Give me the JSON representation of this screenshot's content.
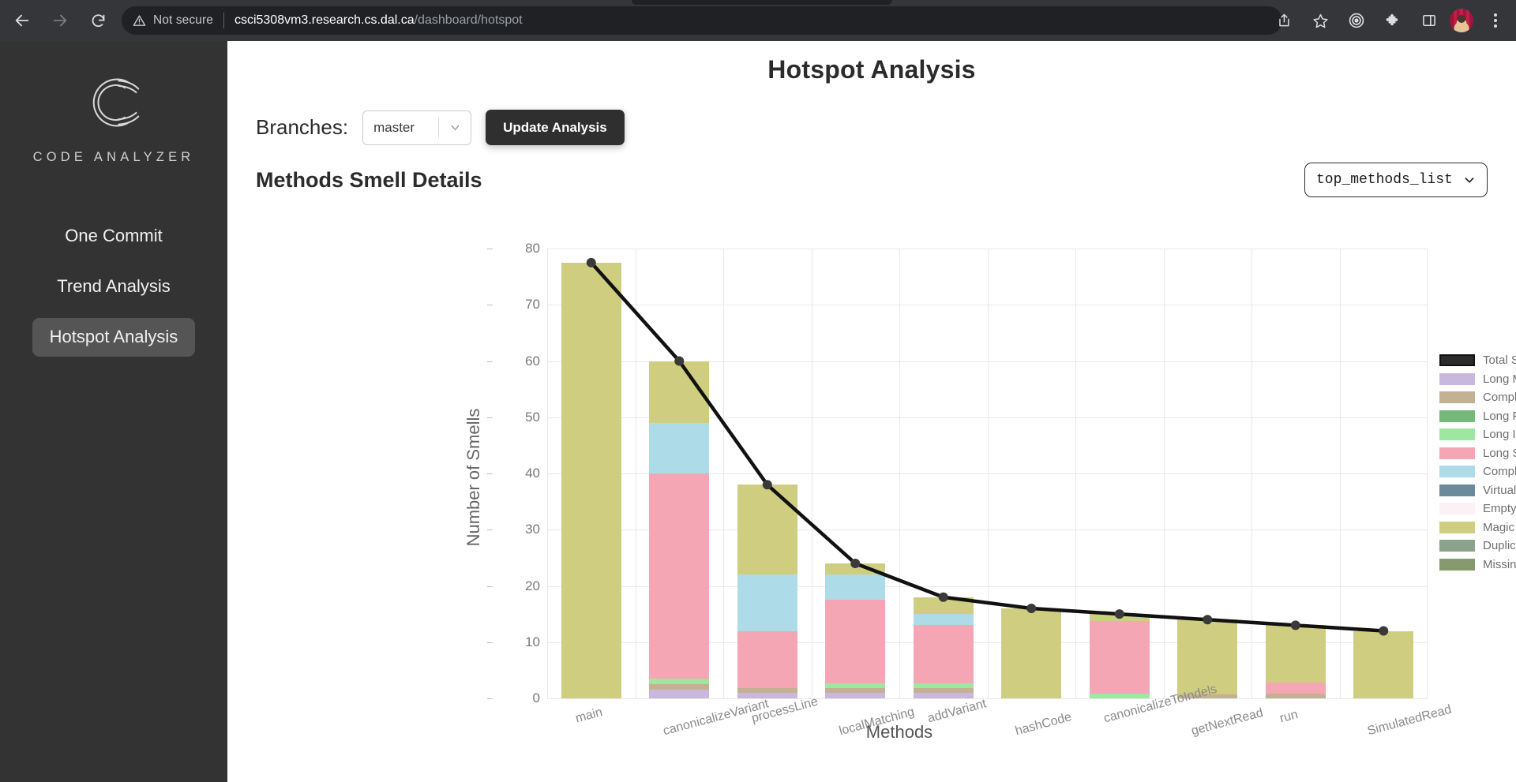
{
  "browser": {
    "back_icon": "back-arrow-icon",
    "forward_icon": "forward-arrow-icon",
    "reload_icon": "reload-icon",
    "security_label": "Not secure",
    "security_icon": "warning-triangle-icon",
    "url_host": "csci5308vm3.research.cs.dal.ca",
    "url_path": "/dashboard/hotspot",
    "actions": [
      {
        "name": "share-icon"
      },
      {
        "name": "bookmark-star-icon"
      },
      {
        "name": "target-circle-icon"
      },
      {
        "name": "extensions-puzzle-icon"
      },
      {
        "name": "side-panel-icon"
      }
    ],
    "profile_name": "avatar",
    "menu_name": "browser-menu-icon"
  },
  "sidebar": {
    "logo_text": "CODE ANALYZER",
    "logo_icon": "code-analyzer-c-logo",
    "items": [
      {
        "label": "One Commit",
        "active": false
      },
      {
        "label": "Trend Analysis",
        "active": false
      },
      {
        "label": "Hotspot Analysis",
        "active": true
      }
    ]
  },
  "header": {
    "title": "Hotspot Analysis",
    "branches_label": "Branches:",
    "branch_value": "master",
    "branch_options": [
      "master"
    ],
    "update_button": "Update Analysis"
  },
  "section": {
    "title": "Methods Smell Details",
    "methods_list_value": "top_methods_list",
    "methods_list_options": [
      "top_methods_list"
    ]
  },
  "chart_data": {
    "type": "bar",
    "stacked": true,
    "title": "Methods Smell Details",
    "xlabel": "Methods",
    "ylabel": "Number of Smells",
    "ylim": [
      0,
      80
    ],
    "yticks": [
      0,
      10,
      20,
      30,
      40,
      50,
      60,
      70,
      80
    ],
    "grid": true,
    "legend_position": "right",
    "categories": [
      "main",
      "canonicalizeVariant",
      "processLine",
      "localMatching",
      "addVariant",
      "hashCode",
      "canonicalizeToIndels",
      "getNextRead",
      "run",
      "SimulatedRead"
    ],
    "series": [
      {
        "name": "Long Method",
        "color": "#c9b8dd",
        "values": [
          0,
          1.5,
          1.0,
          1.0,
          1.0,
          0,
          0,
          0,
          0,
          0
        ]
      },
      {
        "name": "Complex Method",
        "color": "#c2b293",
        "values": [
          0,
          1.0,
          0.8,
          0.8,
          0.8,
          0,
          0,
          0.7,
          0.8,
          0
        ]
      },
      {
        "name": "Long Parameter List",
        "color": "#74b97a",
        "values": [
          0,
          0,
          0,
          0,
          0,
          0,
          0,
          0,
          0,
          0
        ]
      },
      {
        "name": "Long Identifier",
        "color": "#9fe6a0",
        "values": [
          0,
          1.0,
          0,
          0.9,
          0.9,
          0,
          0.9,
          0,
          0,
          0
        ]
      },
      {
        "name": "Long Statement",
        "color": "#f4a6b5",
        "values": [
          0,
          36.5,
          10.2,
          14.8,
          10.3,
          0,
          12.8,
          0,
          2.0,
          0
        ]
      },
      {
        "name": "Complex Conditional",
        "color": "#aedbe8",
        "values": [
          0,
          9.0,
          10.0,
          4.5,
          2.0,
          0,
          0,
          0,
          0,
          0
        ]
      },
      {
        "name": "Virtual Method Call from Constructor",
        "color": "#6b8b9b",
        "values": [
          0,
          0,
          0,
          0,
          0,
          0,
          0,
          0,
          0,
          0
        ]
      },
      {
        "name": "Empty Catch Clause",
        "color": "#fbf2f6",
        "values": [
          0,
          0,
          0,
          0,
          0,
          0,
          0,
          0,
          0,
          0
        ]
      },
      {
        "name": "Magic Number",
        "color": "#cfcd80",
        "values": [
          77.5,
          11.0,
          16.0,
          2.0,
          3.0,
          16.0,
          1.3,
          13.3,
          10.2,
          12.0
        ]
      },
      {
        "name": "Duplicate Code",
        "color": "#8ba38c",
        "values": [
          0,
          0,
          0,
          0,
          0,
          0,
          0,
          0,
          0,
          0
        ]
      },
      {
        "name": "Missing Default",
        "color": "#879a6f",
        "values": [
          0,
          0,
          0,
          0,
          0,
          0,
          0,
          0,
          0,
          0
        ]
      }
    ],
    "total_line": {
      "name": "Total Smell",
      "color": "#111111",
      "values": [
        77.5,
        60,
        38,
        24,
        18,
        16,
        15,
        14,
        13,
        12
      ]
    }
  },
  "legend": {
    "entries": [
      {
        "label": "Total Smell",
        "color": "#2b2b2b",
        "outlined": true
      },
      {
        "label": "Long Method",
        "color": "#c9b8dd",
        "outlined": false
      },
      {
        "label": "Complex Method",
        "color": "#c2b293",
        "outlined": false
      },
      {
        "label": "Long Parameter List",
        "color": "#74b97a",
        "outlined": false
      },
      {
        "label": "Long Identifier",
        "color": "#9fe6a0",
        "outlined": false
      },
      {
        "label": "Long Statement",
        "color": "#f4a6b5",
        "outlined": false
      },
      {
        "label": "Complex Conditional",
        "color": "#aedbe8",
        "outlined": false
      },
      {
        "label": "Virtual Method Call from Constructor",
        "color": "#6b8b9b",
        "outlined": false
      },
      {
        "label": "Empty Catch Clause",
        "color": "#fbf2f6",
        "outlined": false
      },
      {
        "label": "Magic Number",
        "color": "#cfcd80",
        "outlined": false
      },
      {
        "label": "Duplicate Code",
        "color": "#8ba38c",
        "outlined": false
      },
      {
        "label": "Missing Default",
        "color": "#879a6f",
        "outlined": false
      }
    ]
  }
}
